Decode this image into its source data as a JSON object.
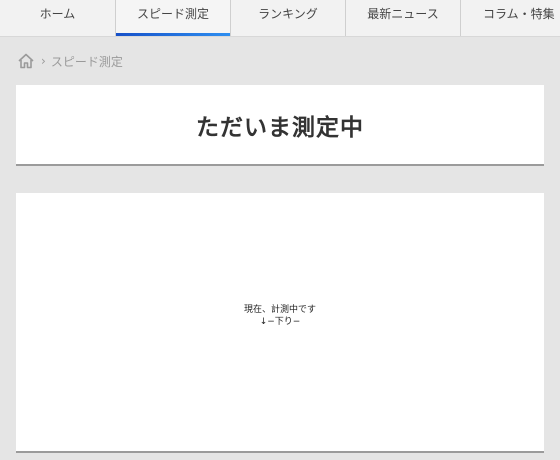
{
  "nav": {
    "items": [
      {
        "label": "ホーム"
      },
      {
        "label": "スピード測定"
      },
      {
        "label": "ランキング"
      },
      {
        "label": "最新ニュース"
      },
      {
        "label": "コラム・特集"
      }
    ],
    "active_index": 1
  },
  "breadcrumb": {
    "home_icon": "home-icon",
    "separator": "›",
    "current": "スピード測定"
  },
  "title": {
    "heading": "ただいま測定中"
  },
  "status": {
    "line1": "現在、計測中です",
    "line2": "↓−下り−"
  },
  "colors": {
    "background": "#e5e5e5",
    "card": "#ffffff",
    "active_underline": "#1f6fe0",
    "breadcrumb_text": "#9a9a9a"
  }
}
